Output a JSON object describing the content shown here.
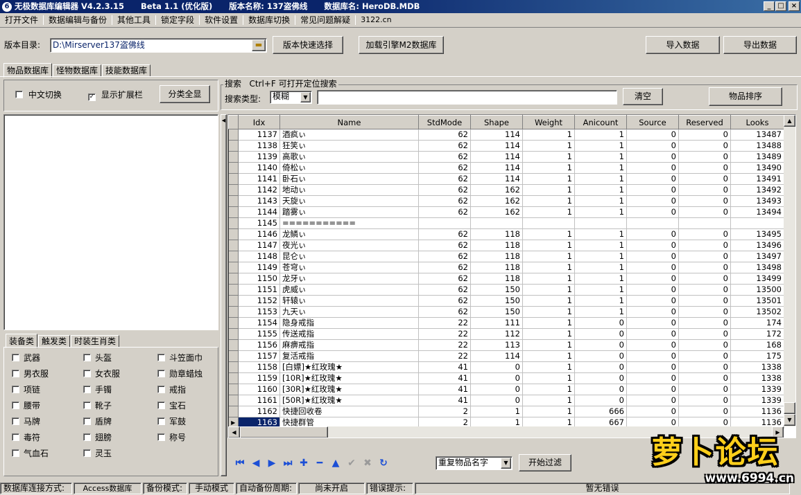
{
  "title": {
    "app": "无极数据库编辑器 V4.2.3.15",
    "beta": "Beta 1.1 (优化版)",
    "version_name": "版本名称: 137盗佛线",
    "db_name": "数据库名: HeroDB.MDB"
  },
  "menu": [
    "打开文件",
    "数据编辑与备份",
    "其他工具",
    "锁定字段",
    "软件设置",
    "数据库切换",
    "常见问题解疑",
    "3122.cn"
  ],
  "toolbar": {
    "dir_label": "版本目录:",
    "dir_value": "D:\\Mirserver137盗佛线",
    "quick_select": "版本快速选择",
    "load_engine": "加载引擎M2数据库",
    "import": "导入数据",
    "export": "导出数据"
  },
  "tabs": [
    "物品数据库",
    "怪物数据库",
    "技能数据库"
  ],
  "options": {
    "chinese_switch": "中文切换",
    "chinese_checked": false,
    "show_ext": "显示扩展栏",
    "show_ext_checked": true,
    "show_all_categories": "分类全显"
  },
  "search": {
    "group_label": "搜索   Ctrl+F 可打开定位搜索",
    "type_label": "搜索类型:",
    "type_value": "模糊",
    "query": "",
    "clear": "清空",
    "sort": "物品排序"
  },
  "category_tabs": [
    "装备类",
    "触发类",
    "时装生肖类"
  ],
  "categories": [
    "武器",
    "头盔",
    "斗笠面巾",
    "男衣服",
    "女衣服",
    "勋章蜡烛",
    "项链",
    "手镯",
    "戒指",
    "腰带",
    "靴子",
    "宝石",
    "马牌",
    "盾牌",
    "军鼓",
    "毒符",
    "翅膀",
    "称号",
    "气血石",
    "灵玉"
  ],
  "grid": {
    "columns": [
      "Idx",
      "Name",
      "StdMode",
      "Shape",
      "Weight",
      "Anicount",
      "Source",
      "Reserved",
      "Looks"
    ],
    "selected_idx": "1163",
    "rows": [
      [
        "1137",
        "酒疯ぃ",
        "62",
        "114",
        "1",
        "1",
        "0",
        "0",
        "13487"
      ],
      [
        "1138",
        "狂笑ぃ",
        "62",
        "114",
        "1",
        "1",
        "0",
        "0",
        "13488"
      ],
      [
        "1139",
        "高歌ぃ",
        "62",
        "114",
        "1",
        "1",
        "0",
        "0",
        "13489"
      ],
      [
        "1140",
        "倚松ぃ",
        "62",
        "114",
        "1",
        "1",
        "0",
        "0",
        "13490"
      ],
      [
        "1141",
        "卧石ぃ",
        "62",
        "114",
        "1",
        "1",
        "0",
        "0",
        "13491"
      ],
      [
        "1142",
        "地动ぃ",
        "62",
        "162",
        "1",
        "1",
        "0",
        "0",
        "13492"
      ],
      [
        "1143",
        "天旋ぃ",
        "62",
        "162",
        "1",
        "1",
        "0",
        "0",
        "13493"
      ],
      [
        "1144",
        "踏雾ぃ",
        "62",
        "162",
        "1",
        "1",
        "0",
        "0",
        "13494"
      ],
      [
        "1145",
        "===========",
        "",
        "",
        "",
        "",
        "",
        "",
        ""
      ],
      [
        "1146",
        "龙鳞ぃ",
        "62",
        "118",
        "1",
        "1",
        "0",
        "0",
        "13495"
      ],
      [
        "1147",
        "夜光ぃ",
        "62",
        "118",
        "1",
        "1",
        "0",
        "0",
        "13496"
      ],
      [
        "1148",
        "昆仑ぃ",
        "62",
        "118",
        "1",
        "1",
        "0",
        "0",
        "13497"
      ],
      [
        "1149",
        "苍穹ぃ",
        "62",
        "118",
        "1",
        "1",
        "0",
        "0",
        "13498"
      ],
      [
        "1150",
        "龙牙ぃ",
        "62",
        "118",
        "1",
        "1",
        "0",
        "0",
        "13499"
      ],
      [
        "1151",
        "虎威ぃ",
        "62",
        "150",
        "1",
        "1",
        "0",
        "0",
        "13500"
      ],
      [
        "1152",
        "轩辕ぃ",
        "62",
        "150",
        "1",
        "1",
        "0",
        "0",
        "13501"
      ],
      [
        "1153",
        "九天ぃ",
        "62",
        "150",
        "1",
        "1",
        "0",
        "0",
        "13502"
      ],
      [
        "1154",
        "隐身戒指",
        "22",
        "111",
        "1",
        "0",
        "0",
        "0",
        "174"
      ],
      [
        "1155",
        "传送戒指",
        "22",
        "112",
        "1",
        "0",
        "0",
        "0",
        "172"
      ],
      [
        "1156",
        "麻痹戒指",
        "22",
        "113",
        "1",
        "0",
        "0",
        "0",
        "168"
      ],
      [
        "1157",
        "复活戒指",
        "22",
        "114",
        "1",
        "0",
        "0",
        "0",
        "175"
      ],
      [
        "1158",
        "[白嫖]★红玫瑰★",
        "41",
        "0",
        "1",
        "0",
        "0",
        "0",
        "1338"
      ],
      [
        "1159",
        "[10R]★红玫瑰★",
        "41",
        "0",
        "1",
        "0",
        "0",
        "0",
        "1338"
      ],
      [
        "1160",
        "[30R]★红玫瑰★",
        "41",
        "0",
        "1",
        "0",
        "0",
        "0",
        "1339"
      ],
      [
        "1161",
        "[50R]★红玫瑰★",
        "41",
        "0",
        "1",
        "0",
        "0",
        "0",
        "1339"
      ],
      [
        "1162",
        "快捷回收卷",
        "2",
        "1",
        "1",
        "666",
        "0",
        "0",
        "1136"
      ],
      [
        "1163",
        "快捷群管",
        "2",
        "1",
        "1",
        "667",
        "0",
        "0",
        "1136"
      ]
    ]
  },
  "filter": {
    "dup_value": "重复物品名字",
    "start": "开始过滤"
  },
  "status": {
    "conn_label": "数据库连接方式:",
    "conn_value": "Access数据库",
    "backup_label": "备份模式:",
    "backup_value": "手动模式",
    "auto_label": "自动备份周期:",
    "auto_value": "尚未开启",
    "error_label": "错误提示:",
    "error_value": "暂无错误"
  },
  "watermark": {
    "brand": "萝卜论坛",
    "url": "www.6994.cn"
  }
}
